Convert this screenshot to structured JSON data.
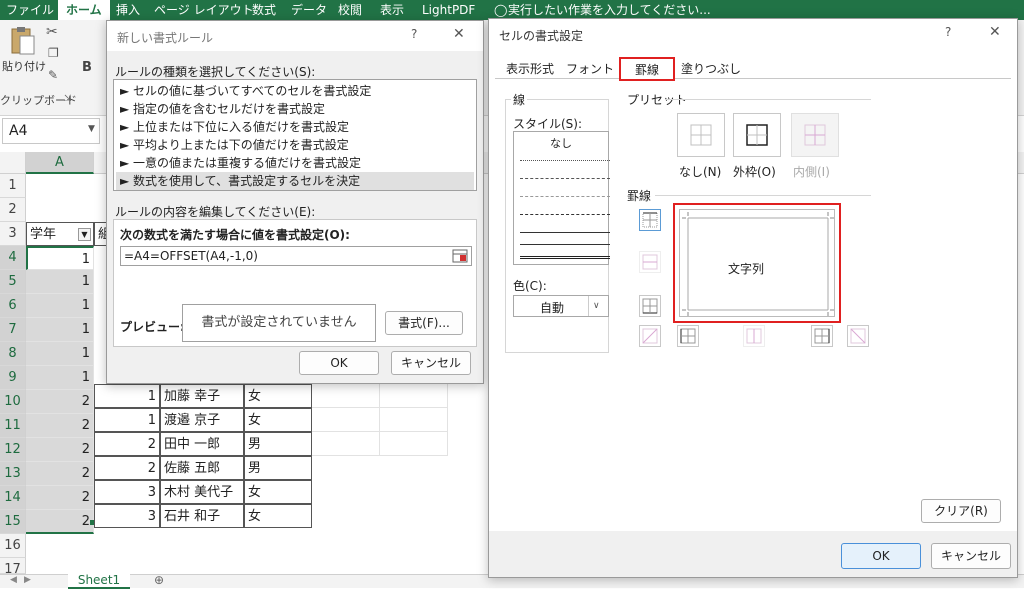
{
  "ribbon": {
    "tabs": [
      "ファイル",
      "ホーム",
      "挿入",
      "ページ レイアウト",
      "数式",
      "データ",
      "校閲",
      "表示",
      "LightPDF"
    ],
    "tell_me": "実行したい作業を入力してください...",
    "paste_label": "貼り付け",
    "clipboard_group": "クリップボード",
    "bold_label": "B"
  },
  "namebox": {
    "value": "A4"
  },
  "grid": {
    "col_a": "A",
    "row_numbers": [
      "1",
      "2",
      "3",
      "4",
      "5",
      "6",
      "7",
      "8",
      "9",
      "10",
      "11",
      "12",
      "13",
      "14",
      "15",
      "16",
      "17"
    ],
    "header": {
      "a": "学年",
      "b": "組"
    },
    "col_a_values": [
      "1",
      "1",
      "1",
      "1",
      "1",
      "1",
      "2",
      "2",
      "2",
      "2",
      "2",
      "2"
    ],
    "rows": [
      {
        "a": "2",
        "b": "1",
        "c": "加藤 幸子",
        "d": "女"
      },
      {
        "a": "2",
        "b": "1",
        "c": "渡邉 京子",
        "d": "女"
      },
      {
        "a": "2",
        "b": "2",
        "c": "田中 一郎",
        "d": "男"
      },
      {
        "a": "2",
        "b": "2",
        "c": "佐藤 五郎",
        "d": "男"
      },
      {
        "a": "2",
        "b": "3",
        "c": "木村 美代子",
        "d": "女"
      },
      {
        "a": "2",
        "b": "3",
        "c": "石井 和子",
        "d": "女"
      }
    ]
  },
  "sheet_tab": "Sheet1",
  "new_rule_dialog": {
    "title": "新しい書式ルール",
    "help": "?",
    "close": "✕",
    "rule_type_label": "ルールの種類を選択してください(S):",
    "rule_types": [
      "► セルの値に基づいてすべてのセルを書式設定",
      "► 指定の値を含むセルだけを書式設定",
      "► 上位または下位に入る値だけを書式設定",
      "► 平均より上または下の値だけを書式設定",
      "► 一意の値または重複する値だけを書式設定",
      "► 数式を使用して、書式設定するセルを決定"
    ],
    "edit_label": "ルールの内容を編集してください(E):",
    "formula_label": "次の数式を満たす場合に値を書式設定(O):",
    "formula_value": "=A4=OFFSET(A4,-1,0)",
    "preview_label": "プレビュー:",
    "preview_text": "書式が設定されていません",
    "format_button": "書式(F)...",
    "ok": "OK",
    "cancel": "キャンセル"
  },
  "format_cells_dialog": {
    "title": "セルの書式設定",
    "help": "?",
    "close": "✕",
    "tabs": [
      "表示形式",
      "フォント",
      "罫線",
      "塗りつぶし"
    ],
    "line_group": "線",
    "style_label": "スタイル(S):",
    "none_style": "なし",
    "color_label": "色(C):",
    "color_value": "自動",
    "preset_group": "プリセット",
    "preset_none": "なし(N)",
    "preset_outline": "外枠(O)",
    "preset_inside": "内側(I)",
    "border_group": "罫線",
    "preview_text": "文字列",
    "clear_button": "クリア(R)",
    "ok": "OK",
    "cancel": "キャンセル",
    "highlight_color": "#e02020"
  }
}
